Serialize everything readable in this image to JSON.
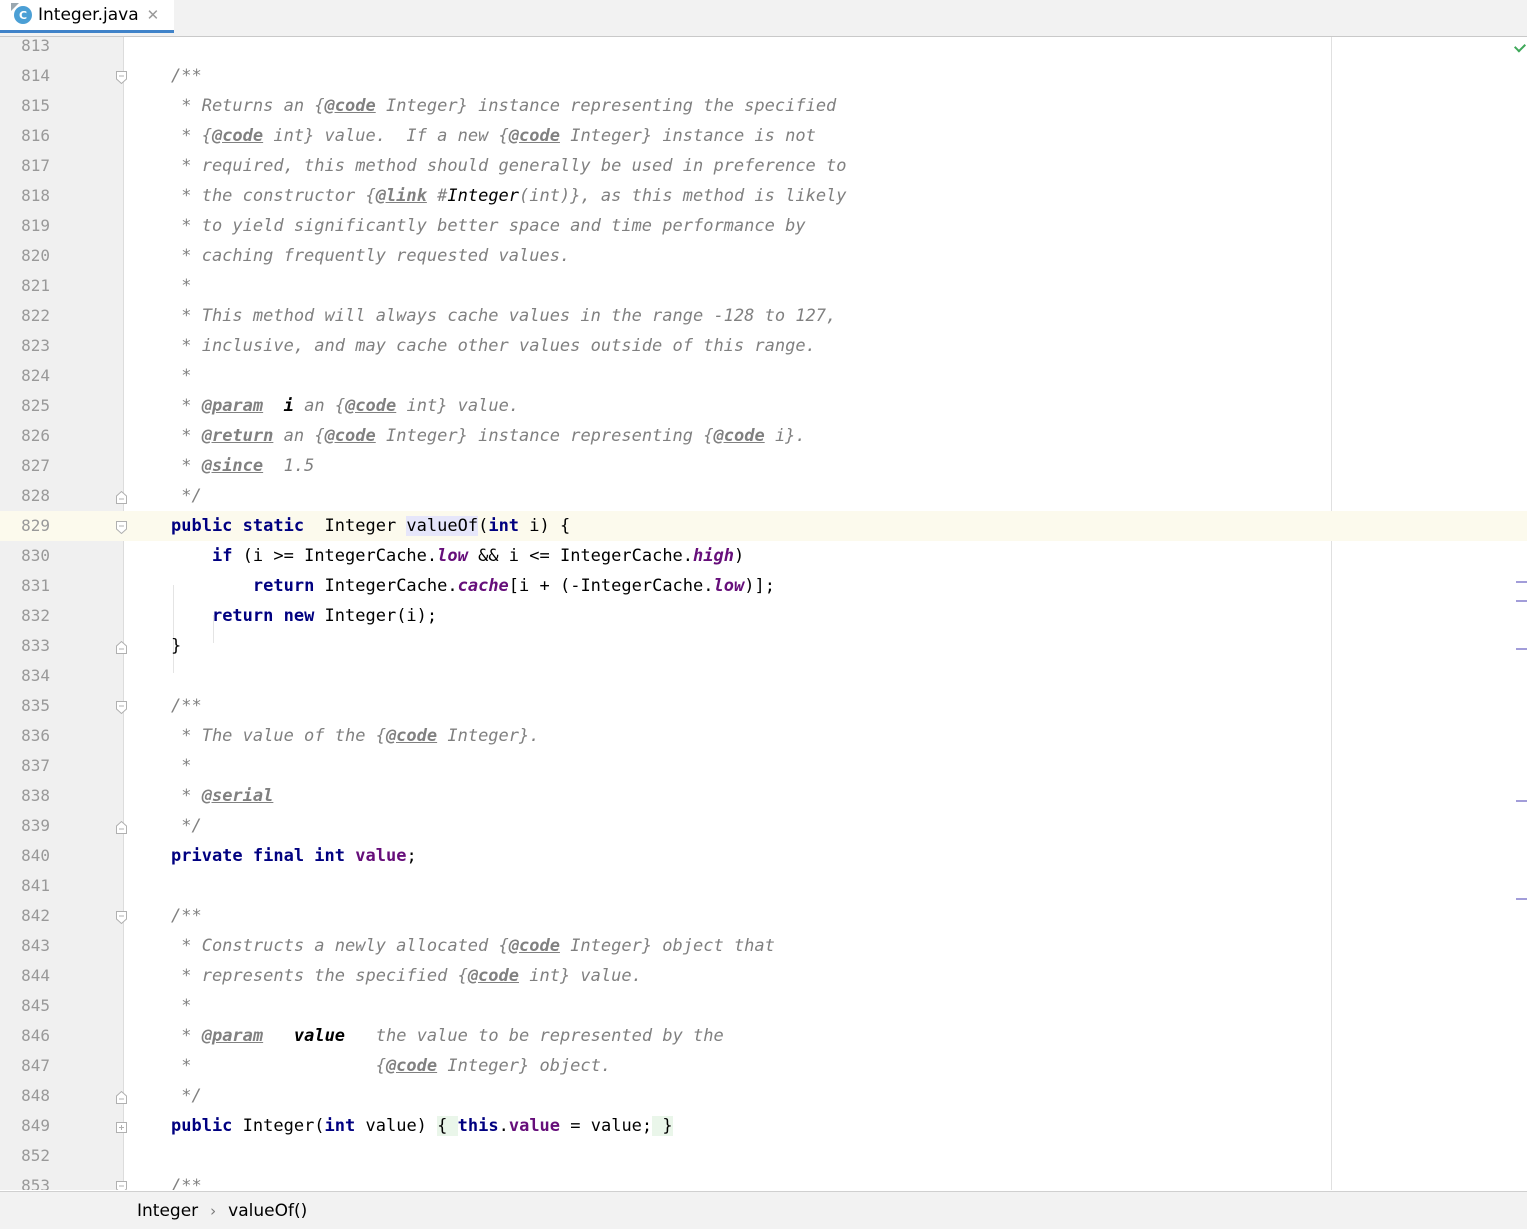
{
  "tab": {
    "icon": "java-class-icon",
    "icon_letter": "C",
    "filename": "Integer.java",
    "close": "✕"
  },
  "breadcrumb": {
    "items": [
      "Integer",
      "valueOf()"
    ],
    "separator": "›"
  },
  "lines": [
    {
      "n": "813",
      "fold": "",
      "tokens": []
    },
    {
      "n": "814",
      "fold": "open",
      "tokens": [
        [
          "cm",
          "/**"
        ]
      ]
    },
    {
      "n": "815",
      "fold": "",
      "tokens": [
        [
          "cm",
          " * Returns an {"
        ],
        [
          "tag",
          "@code"
        ],
        [
          "cm",
          " Integer} instance representing the specified"
        ]
      ]
    },
    {
      "n": "816",
      "fold": "",
      "tokens": [
        [
          "cm",
          " * {"
        ],
        [
          "tag",
          "@code"
        ],
        [
          "cm",
          " int} value.  If a new {"
        ],
        [
          "tag",
          "@code"
        ],
        [
          "cm",
          " Integer} instance is not"
        ]
      ]
    },
    {
      "n": "817",
      "fold": "",
      "tokens": [
        [
          "cm",
          " * required, this method should generally be used in preference to"
        ]
      ]
    },
    {
      "n": "818",
      "fold": "",
      "tokens": [
        [
          "cm",
          " * the constructor {"
        ],
        [
          "tag",
          "@link"
        ],
        [
          "cm",
          " #"
        ],
        [
          "lnk",
          "Integer"
        ],
        [
          "cm",
          "(int)}, as this method is likely"
        ]
      ]
    },
    {
      "n": "819",
      "fold": "",
      "tokens": [
        [
          "cm",
          " * to yield significantly better space and time performance by"
        ]
      ]
    },
    {
      "n": "820",
      "fold": "",
      "tokens": [
        [
          "cm",
          " * caching frequently requested values."
        ]
      ]
    },
    {
      "n": "821",
      "fold": "",
      "tokens": [
        [
          "cm",
          " *"
        ]
      ]
    },
    {
      "n": "822",
      "fold": "",
      "tokens": [
        [
          "cm",
          " * This method will always cache values in the range -128 to 127,"
        ]
      ]
    },
    {
      "n": "823",
      "fold": "",
      "tokens": [
        [
          "cm",
          " * inclusive, and may cache other values outside of this range."
        ]
      ]
    },
    {
      "n": "824",
      "fold": "",
      "tokens": [
        [
          "cm",
          " *"
        ]
      ]
    },
    {
      "n": "825",
      "fold": "",
      "tokens": [
        [
          "cm",
          " * "
        ],
        [
          "tag",
          "@param"
        ],
        [
          "cm",
          "  "
        ],
        [
          "pb",
          "i"
        ],
        [
          "cm",
          " an {"
        ],
        [
          "tag",
          "@code"
        ],
        [
          "cm",
          " int} value."
        ]
      ]
    },
    {
      "n": "826",
      "fold": "",
      "tokens": [
        [
          "cm",
          " * "
        ],
        [
          "tag",
          "@return"
        ],
        [
          "cm",
          " an {"
        ],
        [
          "tag",
          "@code"
        ],
        [
          "cm",
          " Integer} instance representing {"
        ],
        [
          "tag",
          "@code"
        ],
        [
          "cm",
          " i}."
        ]
      ]
    },
    {
      "n": "827",
      "fold": "",
      "tokens": [
        [
          "cm",
          " * "
        ],
        [
          "tag",
          "@since"
        ],
        [
          "cm",
          "  1.5"
        ]
      ]
    },
    {
      "n": "828",
      "fold": "end",
      "tokens": [
        [
          "cm",
          " */"
        ]
      ]
    },
    {
      "n": "829",
      "fold": "open",
      "current": true,
      "tokens": [
        [
          "kw",
          "public static"
        ],
        [
          "",
          "  Integer "
        ],
        [
          "caret",
          ""
        ],
        [
          "hl",
          "valueOf"
        ],
        [
          "",
          "("
        ],
        [
          "kw",
          "int"
        ],
        [
          "",
          " i) {"
        ]
      ]
    },
    {
      "n": "830",
      "fold": "",
      "tokens": [
        [
          "",
          "    "
        ],
        [
          "kw",
          "if"
        ],
        [
          "",
          " (i >= IntegerCache."
        ],
        [
          "fld",
          "low"
        ],
        [
          "",
          " && i <= IntegerCache."
        ],
        [
          "fld",
          "high"
        ],
        [
          "",
          ")"
        ]
      ]
    },
    {
      "n": "831",
      "fold": "",
      "tokens": [
        [
          "",
          "        "
        ],
        [
          "kw",
          "return"
        ],
        [
          "",
          " IntegerCache."
        ],
        [
          "fld",
          "cache"
        ],
        [
          "",
          "[i + (-IntegerCache."
        ],
        [
          "fld",
          "low"
        ],
        [
          "",
          ")];"
        ]
      ]
    },
    {
      "n": "832",
      "fold": "",
      "tokens": [
        [
          "",
          "    "
        ],
        [
          "kw",
          "return new"
        ],
        [
          "",
          " Integer(i);"
        ]
      ]
    },
    {
      "n": "833",
      "fold": "end",
      "tokens": [
        [
          "",
          "}"
        ]
      ]
    },
    {
      "n": "834",
      "fold": "",
      "tokens": []
    },
    {
      "n": "835",
      "fold": "open",
      "tokens": [
        [
          "cm",
          "/**"
        ]
      ]
    },
    {
      "n": "836",
      "fold": "",
      "tokens": [
        [
          "cm",
          " * The value of the {"
        ],
        [
          "tag",
          "@code"
        ],
        [
          "cm",
          " Integer}."
        ]
      ]
    },
    {
      "n": "837",
      "fold": "",
      "tokens": [
        [
          "cm",
          " *"
        ]
      ]
    },
    {
      "n": "838",
      "fold": "",
      "tokens": [
        [
          "cm",
          " * "
        ],
        [
          "tag",
          "@serial"
        ]
      ]
    },
    {
      "n": "839",
      "fold": "end",
      "tokens": [
        [
          "cm",
          " */"
        ]
      ]
    },
    {
      "n": "840",
      "fold": "",
      "tokens": [
        [
          "kw",
          "private final int"
        ],
        [
          "",
          " "
        ],
        [
          "ivar",
          "value"
        ],
        [
          "",
          ";"
        ]
      ]
    },
    {
      "n": "841",
      "fold": "",
      "tokens": []
    },
    {
      "n": "842",
      "fold": "open",
      "tokens": [
        [
          "cm",
          "/**"
        ]
      ]
    },
    {
      "n": "843",
      "fold": "",
      "tokens": [
        [
          "cm",
          " * Constructs a newly allocated {"
        ],
        [
          "tag",
          "@code"
        ],
        [
          "cm",
          " Integer} object that"
        ]
      ]
    },
    {
      "n": "844",
      "fold": "",
      "tokens": [
        [
          "cm",
          " * represents the specified {"
        ],
        [
          "tag",
          "@code"
        ],
        [
          "cm",
          " int} value."
        ]
      ]
    },
    {
      "n": "845",
      "fold": "",
      "tokens": [
        [
          "cm",
          " *"
        ]
      ]
    },
    {
      "n": "846",
      "fold": "",
      "tokens": [
        [
          "cm",
          " * "
        ],
        [
          "tag",
          "@param"
        ],
        [
          "cm",
          "   "
        ],
        [
          "pb",
          "value"
        ],
        [
          "cm",
          "   the value to be represented by the"
        ]
      ]
    },
    {
      "n": "847",
      "fold": "",
      "tokens": [
        [
          "cm",
          " *                  {"
        ],
        [
          "tag",
          "@code"
        ],
        [
          "cm",
          " Integer} object."
        ]
      ]
    },
    {
      "n": "848",
      "fold": "end",
      "tokens": [
        [
          "cm",
          " */"
        ]
      ]
    },
    {
      "n": "849",
      "fold": "collapsed",
      "tokens": [
        [
          "kw",
          "public"
        ],
        [
          "",
          " Integer("
        ],
        [
          "kw",
          "int"
        ],
        [
          "",
          " value) "
        ],
        [
          "brc",
          "{ "
        ],
        [
          "kw",
          "this"
        ],
        [
          "",
          "."
        ],
        [
          "ivar",
          "value"
        ],
        [
          "",
          " = value;"
        ],
        [
          "brc",
          " }"
        ]
      ]
    },
    {
      "n": "852",
      "fold": "",
      "tokens": []
    },
    {
      "n": "853",
      "fold": "open",
      "tokens": [
        [
          "cm",
          "/**"
        ]
      ]
    }
  ]
}
